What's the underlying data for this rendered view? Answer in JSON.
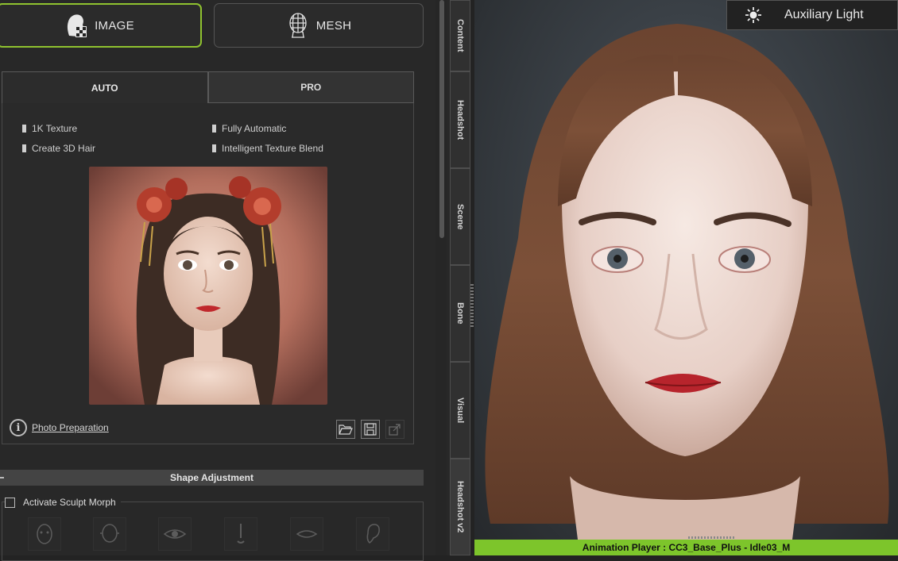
{
  "mode_buttons": {
    "image_label": "IMAGE",
    "mesh_label": "MESH"
  },
  "tabs": {
    "auto_label": "AUTO",
    "pro_label": "PRO"
  },
  "features": {
    "texture": "1K Texture",
    "automatic": "Fully Automatic",
    "hair": "Create 3D Hair",
    "blend": "Intelligent Texture Blend"
  },
  "photo_preparation_label": "Photo Preparation",
  "section_title": "Shape Adjustment",
  "sculpt_morph_label": "Activate Sculpt Morph",
  "side_tabs": [
    "Content",
    "Headshot",
    "Scene",
    "Bone",
    "Visual",
    "Headshot v2"
  ],
  "aux_light_label": "Auxiliary Light",
  "animation_player_label": "Animation Player : CC3_Base_Plus - Idle03_M",
  "icons": {
    "image_mode": "head-checker-icon",
    "mesh_mode": "mesh-head-icon",
    "info": "info-icon",
    "open": "folder-open-icon",
    "save": "save-icon",
    "export": "export-icon",
    "aux_light": "sun-icon"
  },
  "colors": {
    "accent_green": "#8fc22f",
    "player_bar": "#7dc52b"
  }
}
